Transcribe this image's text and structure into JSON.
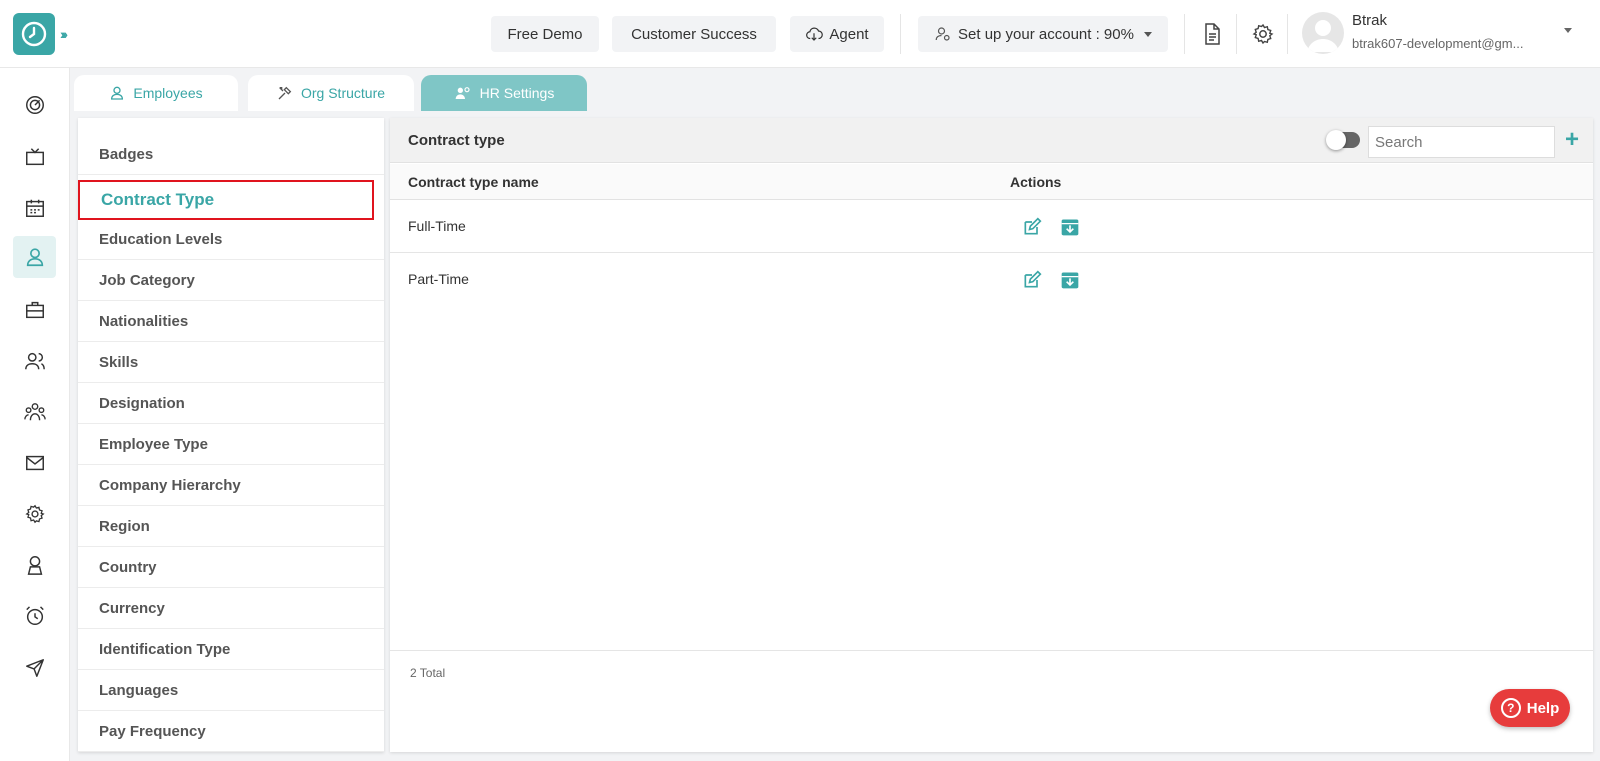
{
  "header": {
    "buttons": {
      "free_demo": "Free Demo",
      "customer_success": "Customer Success",
      "agent": "Agent",
      "setup": "Set up your account : 90%"
    },
    "user": {
      "name": "Btrak",
      "email": "btrak607-development@gm..."
    }
  },
  "sidebar": {
    "icons": [
      "dashboard-icon",
      "tv-icon",
      "calendar-icon",
      "user-icon",
      "briefcase-icon",
      "users-icon",
      "team-icon",
      "mail-icon",
      "settings-icon",
      "profile-badge-icon",
      "alarm-icon",
      "send-icon"
    ],
    "active_index": 3
  },
  "tabs": [
    {
      "label": "Employees"
    },
    {
      "label": "Org Structure"
    },
    {
      "label": "HR Settings"
    }
  ],
  "menu": {
    "items": [
      {
        "label": "Badges"
      },
      {
        "label": "Contract Type"
      },
      {
        "label": "Education Levels"
      },
      {
        "label": "Job Category"
      },
      {
        "label": "Nationalities"
      },
      {
        "label": "Skills"
      },
      {
        "label": "Designation"
      },
      {
        "label": "Employee Type"
      },
      {
        "label": "Company Hierarchy"
      },
      {
        "label": "Region"
      },
      {
        "label": "Country"
      },
      {
        "label": "Currency"
      },
      {
        "label": "Identification Type"
      },
      {
        "label": "Languages"
      },
      {
        "label": "Pay Frequency"
      }
    ],
    "selected_index": 1
  },
  "panel": {
    "title": "Contract type",
    "search_placeholder": "Search",
    "columns": {
      "name": "Contract type name",
      "actions": "Actions"
    },
    "rows": [
      {
        "name": "Full-Time"
      },
      {
        "name": "Part-Time"
      }
    ],
    "total": "2 Total"
  },
  "help": {
    "label": "Help"
  },
  "colors": {
    "accent": "#3aa6a6",
    "highlight": "#e0141e",
    "help": "#e73c3c"
  }
}
